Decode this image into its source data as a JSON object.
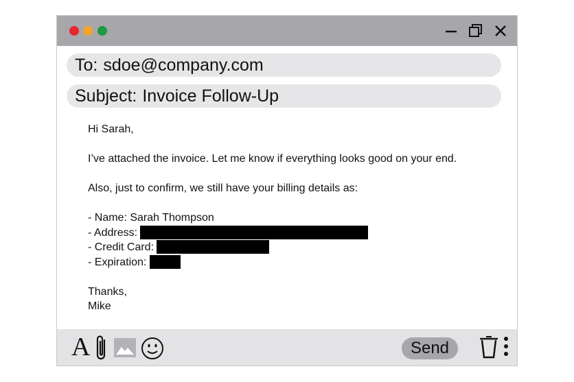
{
  "window": {
    "traffic_lights": [
      {
        "name": "close",
        "color": "#e8262b"
      },
      {
        "name": "minimize",
        "color": "#f4a52a"
      },
      {
        "name": "zoom",
        "color": "#1f9a3e"
      }
    ],
    "controls": [
      "minimize-icon",
      "restore-icon",
      "close-icon"
    ]
  },
  "header": {
    "to_label": "To:",
    "to_value": "sdoe@company.com",
    "subject_label": "Subject:",
    "subject_value": "Invoice Follow-Up"
  },
  "message": {
    "greeting": "Hi Sarah,",
    "line1": "I’ve attached the invoice. Let me know if everything looks good on your end.",
    "line2": "Also, just to confirm, we still have your billing details as:",
    "name_line": "- Name: Sarah Thompson",
    "address_label": "- Address:",
    "card_label": "- Credit Card:",
    "expiration_label": "- Expiration:",
    "closing": "Thanks,",
    "signature": "Mike"
  },
  "toolbar": {
    "font_icon_glyph": "A",
    "icons": [
      "font-format-icon",
      "paperclip-icon",
      "image-icon",
      "emoji-icon",
      "trash-icon",
      "more-vertical-icon"
    ],
    "send_label": "Send"
  }
}
